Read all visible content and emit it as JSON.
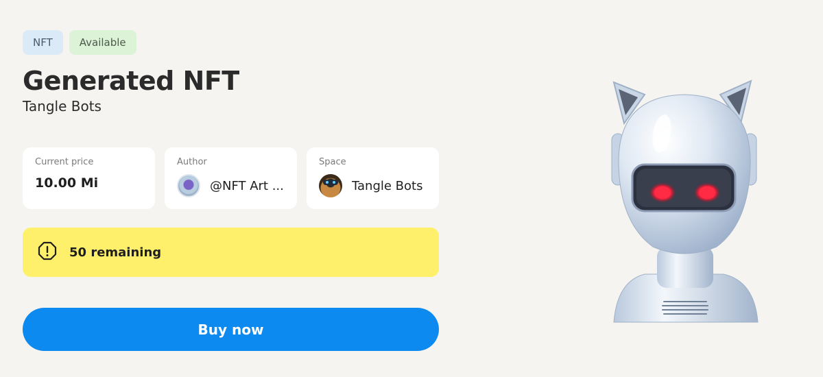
{
  "badges": {
    "nft": "NFT",
    "available": "Available"
  },
  "title": "Generated NFT",
  "subtitle": "Tangle Bots",
  "price_card": {
    "label": "Current price",
    "value": "10.00 Mi"
  },
  "author_card": {
    "label": "Author",
    "value": "@NFT Art ..."
  },
  "space_card": {
    "label": "Space",
    "value": "Tangle Bots"
  },
  "remaining": {
    "text": "50 remaining",
    "icon": "warning-octagon-icon"
  },
  "buy_button": {
    "label": "Buy now"
  },
  "colors": {
    "background": "#f5f4f0",
    "accent": "#0d8af0",
    "warning": "#fff06b",
    "badge_nft": "#dbeaf7",
    "badge_available": "#dcf3d7"
  }
}
